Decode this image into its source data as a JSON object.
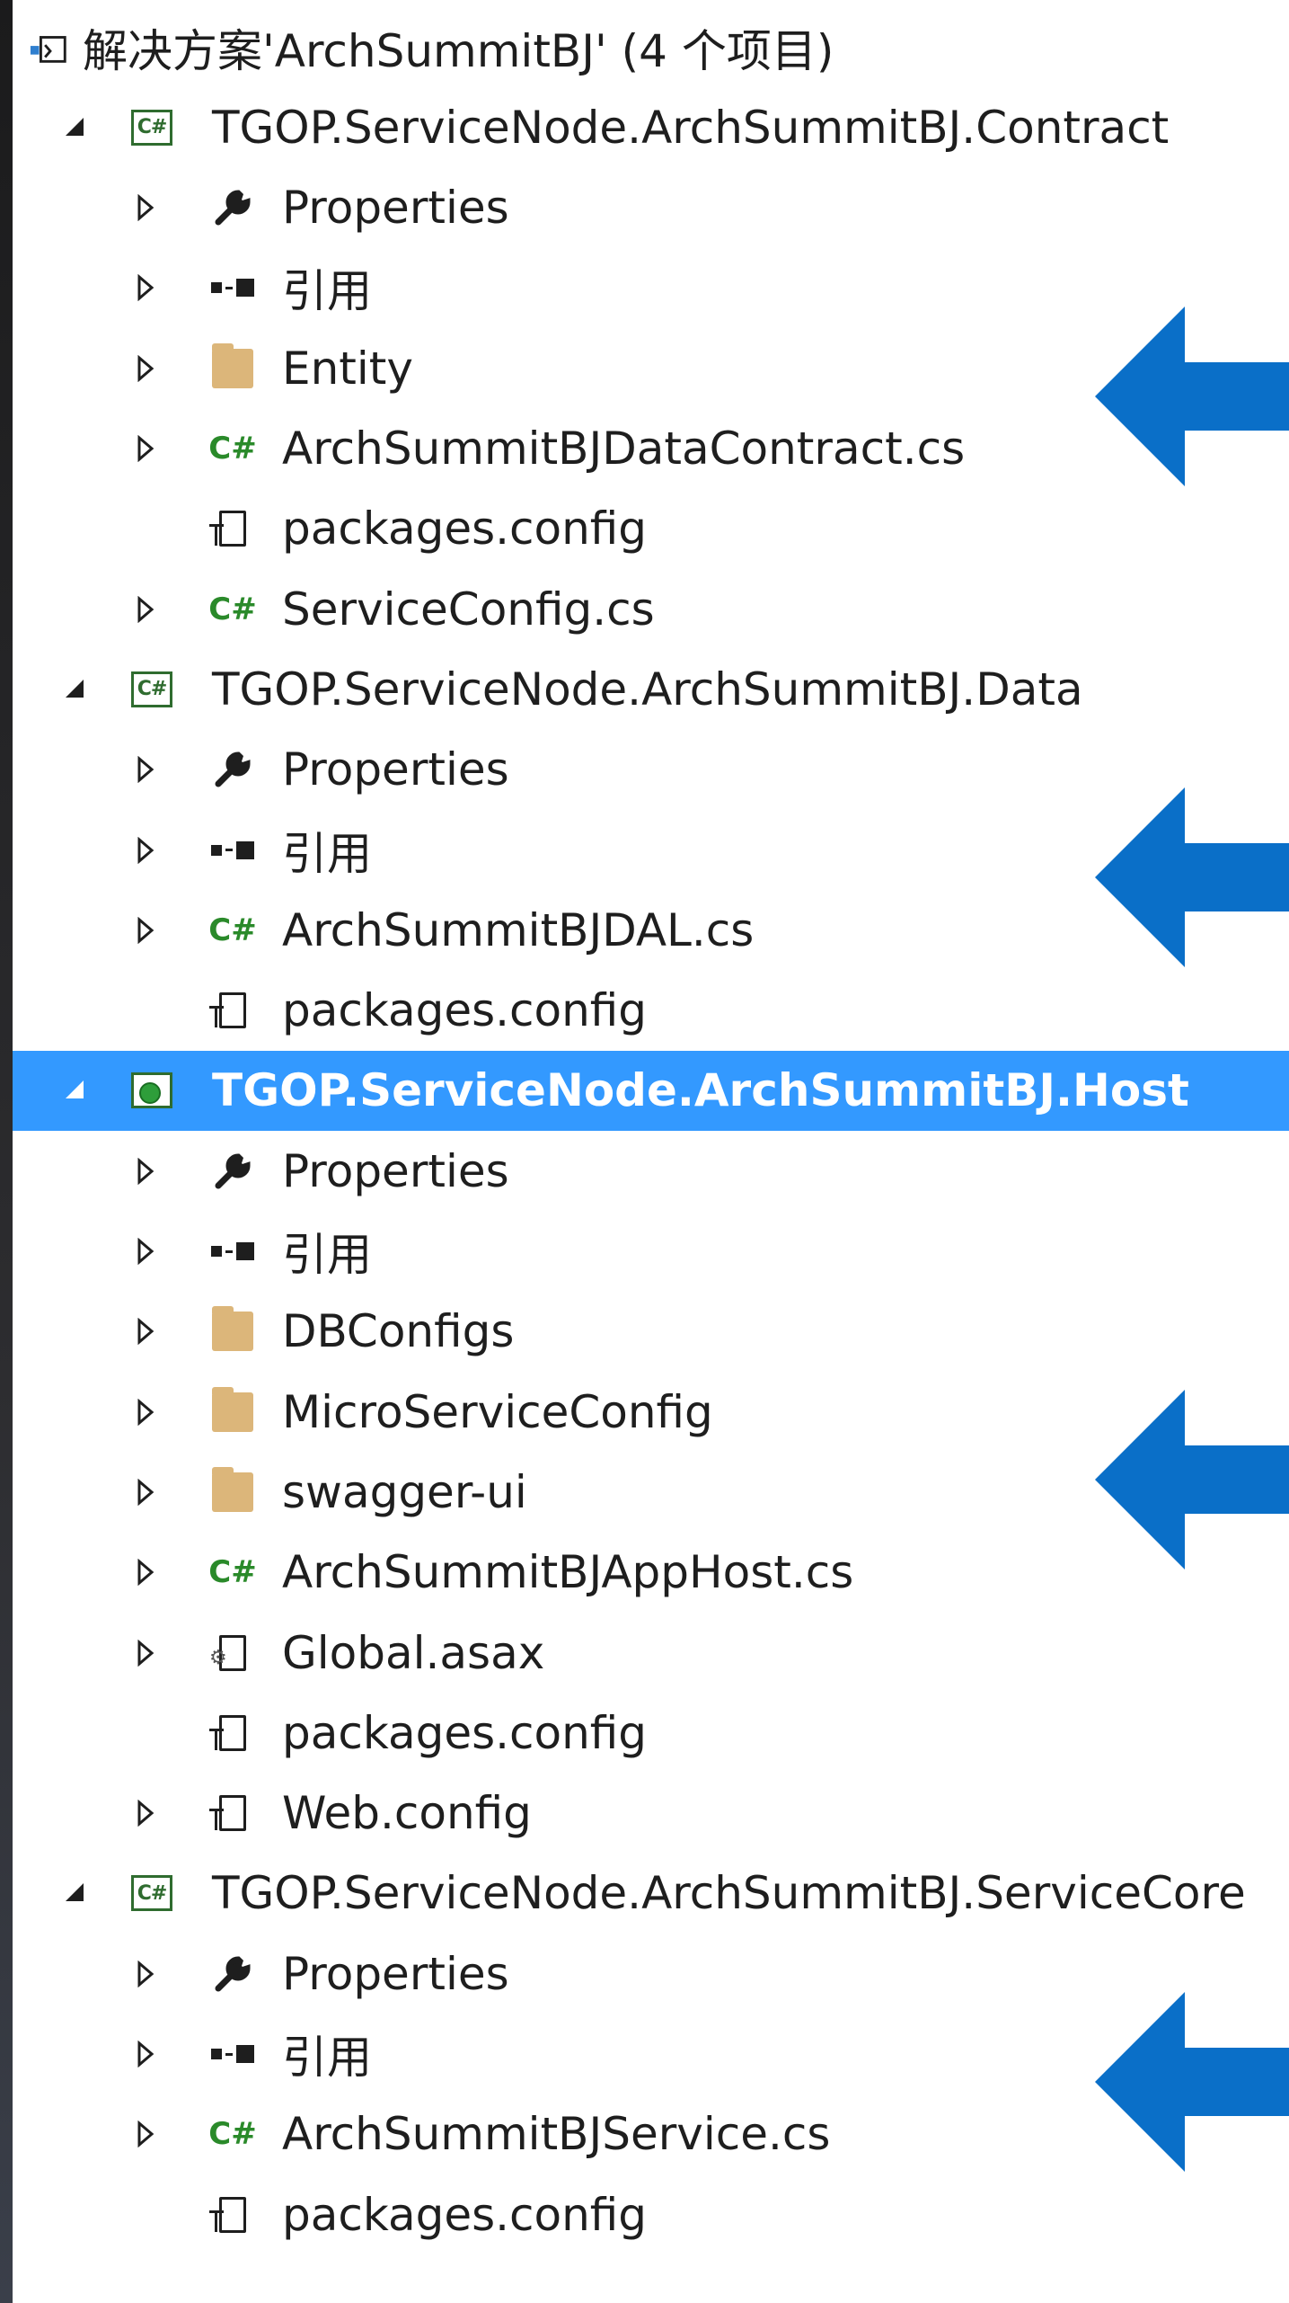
{
  "solution": {
    "label": "解决方案'ArchSummitBJ' (4 个项目)",
    "icon": "solution-icon"
  },
  "projects": [
    {
      "label": "TGOP.ServiceNode.ArchSummitBJ.Contract",
      "icon": "csharp-project-icon",
      "selected": false,
      "items": [
        {
          "label": "Properties",
          "icon": "wrench-icon",
          "expandable": true
        },
        {
          "label": "引用",
          "icon": "references-icon",
          "expandable": true
        },
        {
          "label": "Entity",
          "icon": "folder-icon",
          "expandable": true
        },
        {
          "label": "ArchSummitBJDataContract.cs",
          "icon": "csharp-file-icon",
          "expandable": true
        },
        {
          "label": "packages.config",
          "icon": "config-file-icon",
          "expandable": false
        },
        {
          "label": "ServiceConfig.cs",
          "icon": "csharp-file-icon",
          "expandable": true
        }
      ]
    },
    {
      "label": "TGOP.ServiceNode.ArchSummitBJ.Data",
      "icon": "csharp-project-icon",
      "selected": false,
      "items": [
        {
          "label": "Properties",
          "icon": "wrench-icon",
          "expandable": true
        },
        {
          "label": "引用",
          "icon": "references-icon",
          "expandable": true
        },
        {
          "label": "ArchSummitBJDAL.cs",
          "icon": "csharp-file-icon",
          "expandable": true
        },
        {
          "label": "packages.config",
          "icon": "config-file-icon",
          "expandable": false
        }
      ]
    },
    {
      "label": "TGOP.ServiceNode.ArchSummitBJ.Host",
      "icon": "web-project-icon",
      "selected": true,
      "items": [
        {
          "label": "Properties",
          "icon": "wrench-icon",
          "expandable": true
        },
        {
          "label": "引用",
          "icon": "references-icon",
          "expandable": true
        },
        {
          "label": "DBConfigs",
          "icon": "folder-icon",
          "expandable": true
        },
        {
          "label": "MicroServiceConfig",
          "icon": "folder-icon",
          "expandable": true
        },
        {
          "label": "swagger-ui",
          "icon": "folder-icon",
          "expandable": true
        },
        {
          "label": "ArchSummitBJAppHost.cs",
          "icon": "csharp-file-icon",
          "expandable": true
        },
        {
          "label": "Global.asax",
          "icon": "asax-file-icon",
          "expandable": true
        },
        {
          "label": "packages.config",
          "icon": "config-file-icon",
          "expandable": false
        },
        {
          "label": "Web.config",
          "icon": "config-file-icon",
          "expandable": true
        }
      ]
    },
    {
      "label": "TGOP.ServiceNode.ArchSummitBJ.ServiceCore",
      "icon": "csharp-project-icon",
      "selected": false,
      "items": [
        {
          "label": "Properties",
          "icon": "wrench-icon",
          "expandable": true
        },
        {
          "label": "引用",
          "icon": "references-icon",
          "expandable": true
        },
        {
          "label": "ArchSummitBJService.cs",
          "icon": "csharp-file-icon",
          "expandable": true
        },
        {
          "label": "packages.config",
          "icon": "config-file-icon",
          "expandable": false
        }
      ]
    }
  ],
  "annotation_arrows": [
    {
      "points_to": "TGOP.ServiceNode.ArchSummitBJ.Contract",
      "color": "#0a6fc8"
    },
    {
      "points_to": "TGOP.ServiceNode.ArchSummitBJ.Data",
      "color": "#0a6fc8"
    },
    {
      "points_to": "TGOP.ServiceNode.ArchSummitBJ.Host",
      "color": "#0a6fc8"
    },
    {
      "points_to": "TGOP.ServiceNode.ArchSummitBJ.ServiceCore",
      "color": "#0a6fc8"
    }
  ],
  "colors": {
    "selection": "#3399ff",
    "csharp_green": "#2a8a2a",
    "folder": "#dcb67a",
    "arrow_blue": "#0a6fc8"
  }
}
